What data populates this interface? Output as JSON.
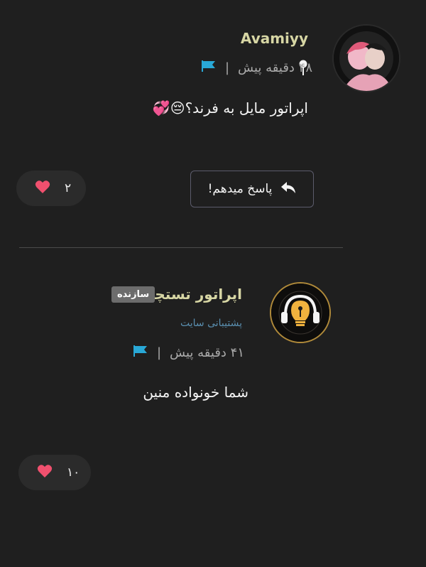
{
  "comments": [
    {
      "username": "Avamiyy",
      "time": "۴۸ دقیقه پیش",
      "separator": "|",
      "text": "اپراتور مایل به فرند؟",
      "emoji": "😔💞",
      "reply_label": "پاسخ میدهم!",
      "likes": "۲"
    },
    {
      "username": "اپراتور تستچی",
      "badge": "سازنده",
      "role": "پشتیبانی سایت",
      "time": "۴۱ دقیقه پیش",
      "separator": "|",
      "text": "شما خونواده منین",
      "likes": "۱۰"
    }
  ],
  "icons": {
    "pin": "pin-icon",
    "flag": "flag-icon",
    "reply": "reply-arrow-icon",
    "heart": "heart-icon"
  },
  "colors": {
    "background": "#1f1f1f",
    "username": "#d7d6a4",
    "flag": "#29a8d6",
    "heart": "#f0506e",
    "role": "#5a8fb0"
  }
}
